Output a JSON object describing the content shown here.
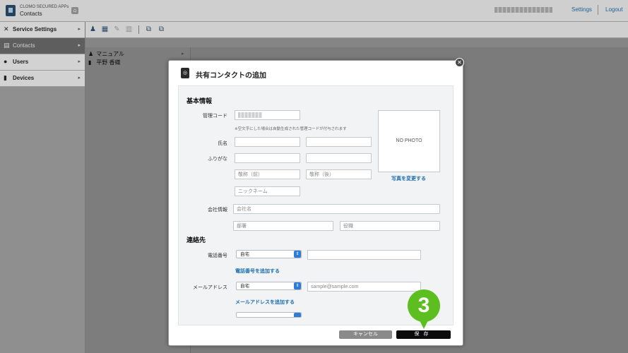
{
  "app": {
    "name": "CLOMO SECURED APPs",
    "title": "Contacts",
    "settings_link": "Settings",
    "logout_link": "Logout"
  },
  "sidebar": {
    "items": [
      {
        "label": "Service Settings",
        "icon": "wrench-screwdriver-icon"
      },
      {
        "label": "Contacts",
        "icon": "address-book-icon",
        "active": true
      },
      {
        "label": "Users",
        "icon": "user-icon"
      },
      {
        "label": "Devices",
        "icon": "device-icon"
      }
    ]
  },
  "toolbar": {
    "icons": [
      "add-contact-icon",
      "add-shared-contact-icon",
      "edit-icon",
      "delete-icon",
      "import-icon",
      "export-icon"
    ]
  },
  "list": {
    "items": [
      "マニュアル",
      "平野 香織"
    ]
  },
  "modal": {
    "title": "共有コンタクトの追加",
    "basic_section": "基本情報",
    "labels": {
      "code": "管理コード",
      "name": "氏名",
      "furigana": "ふりがな",
      "company": "会社情報",
      "phone": "電話番号",
      "email": "メールアドレス"
    },
    "code_note": "※空文字にした場合は自動生成された管理コードが付与されます",
    "placeholders": {
      "honorific_first": "敬称（前）",
      "honorific_last": "敬称（後）",
      "nickname": "ニックネーム",
      "company_name": "会社名",
      "department": "部署",
      "title": "役職",
      "email": "sample@sample.com"
    },
    "photo_text": "NO PHOTO",
    "change_photo": "写真を変更する",
    "contact_section": "連絡先",
    "phone_type": "自宅",
    "add_phone": "電話番号を追加する",
    "email_type": "自宅",
    "add_email": "メールアドレスを追加する",
    "cancel_button": "キャンセル",
    "save_button": "保存"
  },
  "callout": {
    "number": "3",
    "color": "#5cbf1f"
  }
}
